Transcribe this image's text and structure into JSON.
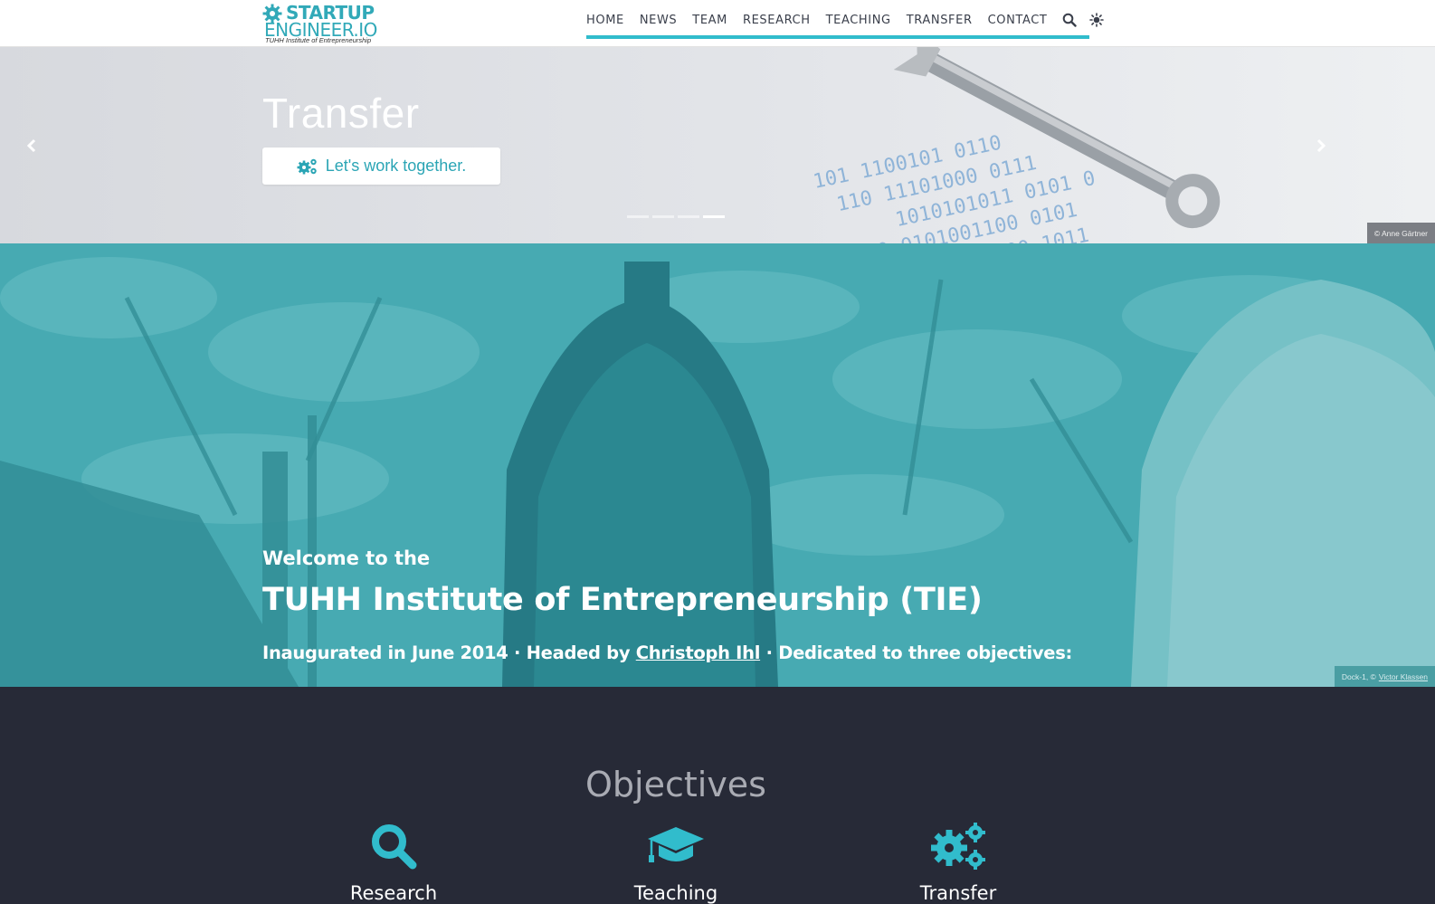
{
  "brand": {
    "line1": "STARTUP",
    "line2": "ENGINEER.IO",
    "line3": "TUHH Institute of Entrepreneurship"
  },
  "nav": {
    "items": [
      "HOME",
      "NEWS",
      "TEAM",
      "RESEARCH",
      "TEACHING",
      "TRANSFER",
      "CONTACT"
    ],
    "icons": [
      "search-icon",
      "theme-toggle-icon"
    ]
  },
  "carousel": {
    "title": "Transfer",
    "cta_label": "Let's work together.",
    "active_slide": 4,
    "slide_count": 4,
    "credit": "© Anne Gärtner"
  },
  "hero": {
    "welcome": "Welcome to the",
    "title": "TUHH Institute of Entrepreneurship (TIE)",
    "sub_before": "Inaugurated in June 2014 · Headed by ",
    "sub_link": "Christoph Ihl",
    "sub_after": " · Dedicated to three objectives:",
    "credit_prefix": "Dock-1, ©",
    "credit_link": "Victor Klassen"
  },
  "objectives": {
    "title": "Objectives",
    "items": [
      {
        "label": "Research",
        "icon": "search-icon"
      },
      {
        "label": "Teaching",
        "icon": "graduation-cap-icon"
      },
      {
        "label": "Transfer",
        "icon": "gears-icon"
      }
    ]
  },
  "colors": {
    "accent": "#31bccc",
    "hero_tint": "#3fa5ad",
    "dark_bg": "#272a37",
    "nav_text": "#3a3f4b"
  }
}
